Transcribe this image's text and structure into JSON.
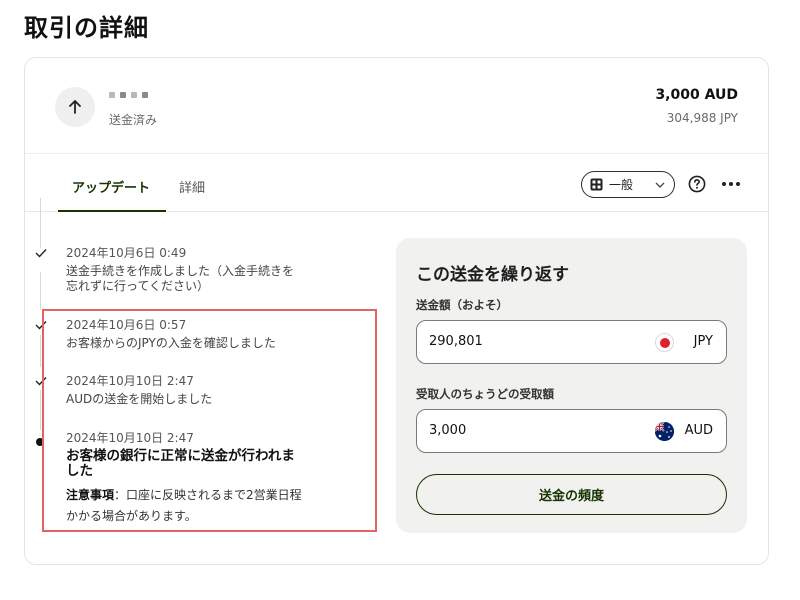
{
  "page": {
    "title": "取引の詳細"
  },
  "summary": {
    "status": "送金済み",
    "amount": "3,000 AUD",
    "converted_amount": "304,988 JPY"
  },
  "tabs": {
    "updates": "アップデート",
    "details": "詳細"
  },
  "view": {
    "selected": "一般"
  },
  "timeline": [
    {
      "date": "2024年10月6日 0:49",
      "text": "送金手続きを作成しました（入金手続きを忘れずに行ってください）",
      "state": "done"
    },
    {
      "date": "2024年10月6日 0:57",
      "text": "お客様からのJPYの入金を確認しました",
      "state": "done"
    },
    {
      "date": "2024年10月10日 2:47",
      "text": "AUDの送金を開始しました",
      "state": "done"
    },
    {
      "date": "2024年10月10日 2:47",
      "title": "お客様の銀行に正常に送金が行われました",
      "note_label": "注意事項",
      "note_text": "：口座に反映されるまで2営業日程かかる場合があります。",
      "state": "current"
    }
  ],
  "repeat": {
    "title": "この送金を繰り返す",
    "send_label": "送金額（およそ）",
    "send_value": "290,801",
    "send_currency": "JPY",
    "receive_label": "受取人のちょうどの受取額",
    "receive_value": "3,000",
    "receive_currency": "AUD",
    "frequency_button": "送金の頻度"
  },
  "colors": {
    "accent": "#163300",
    "highlight": "#e36363",
    "panel_bg": "#f1f1ef"
  }
}
